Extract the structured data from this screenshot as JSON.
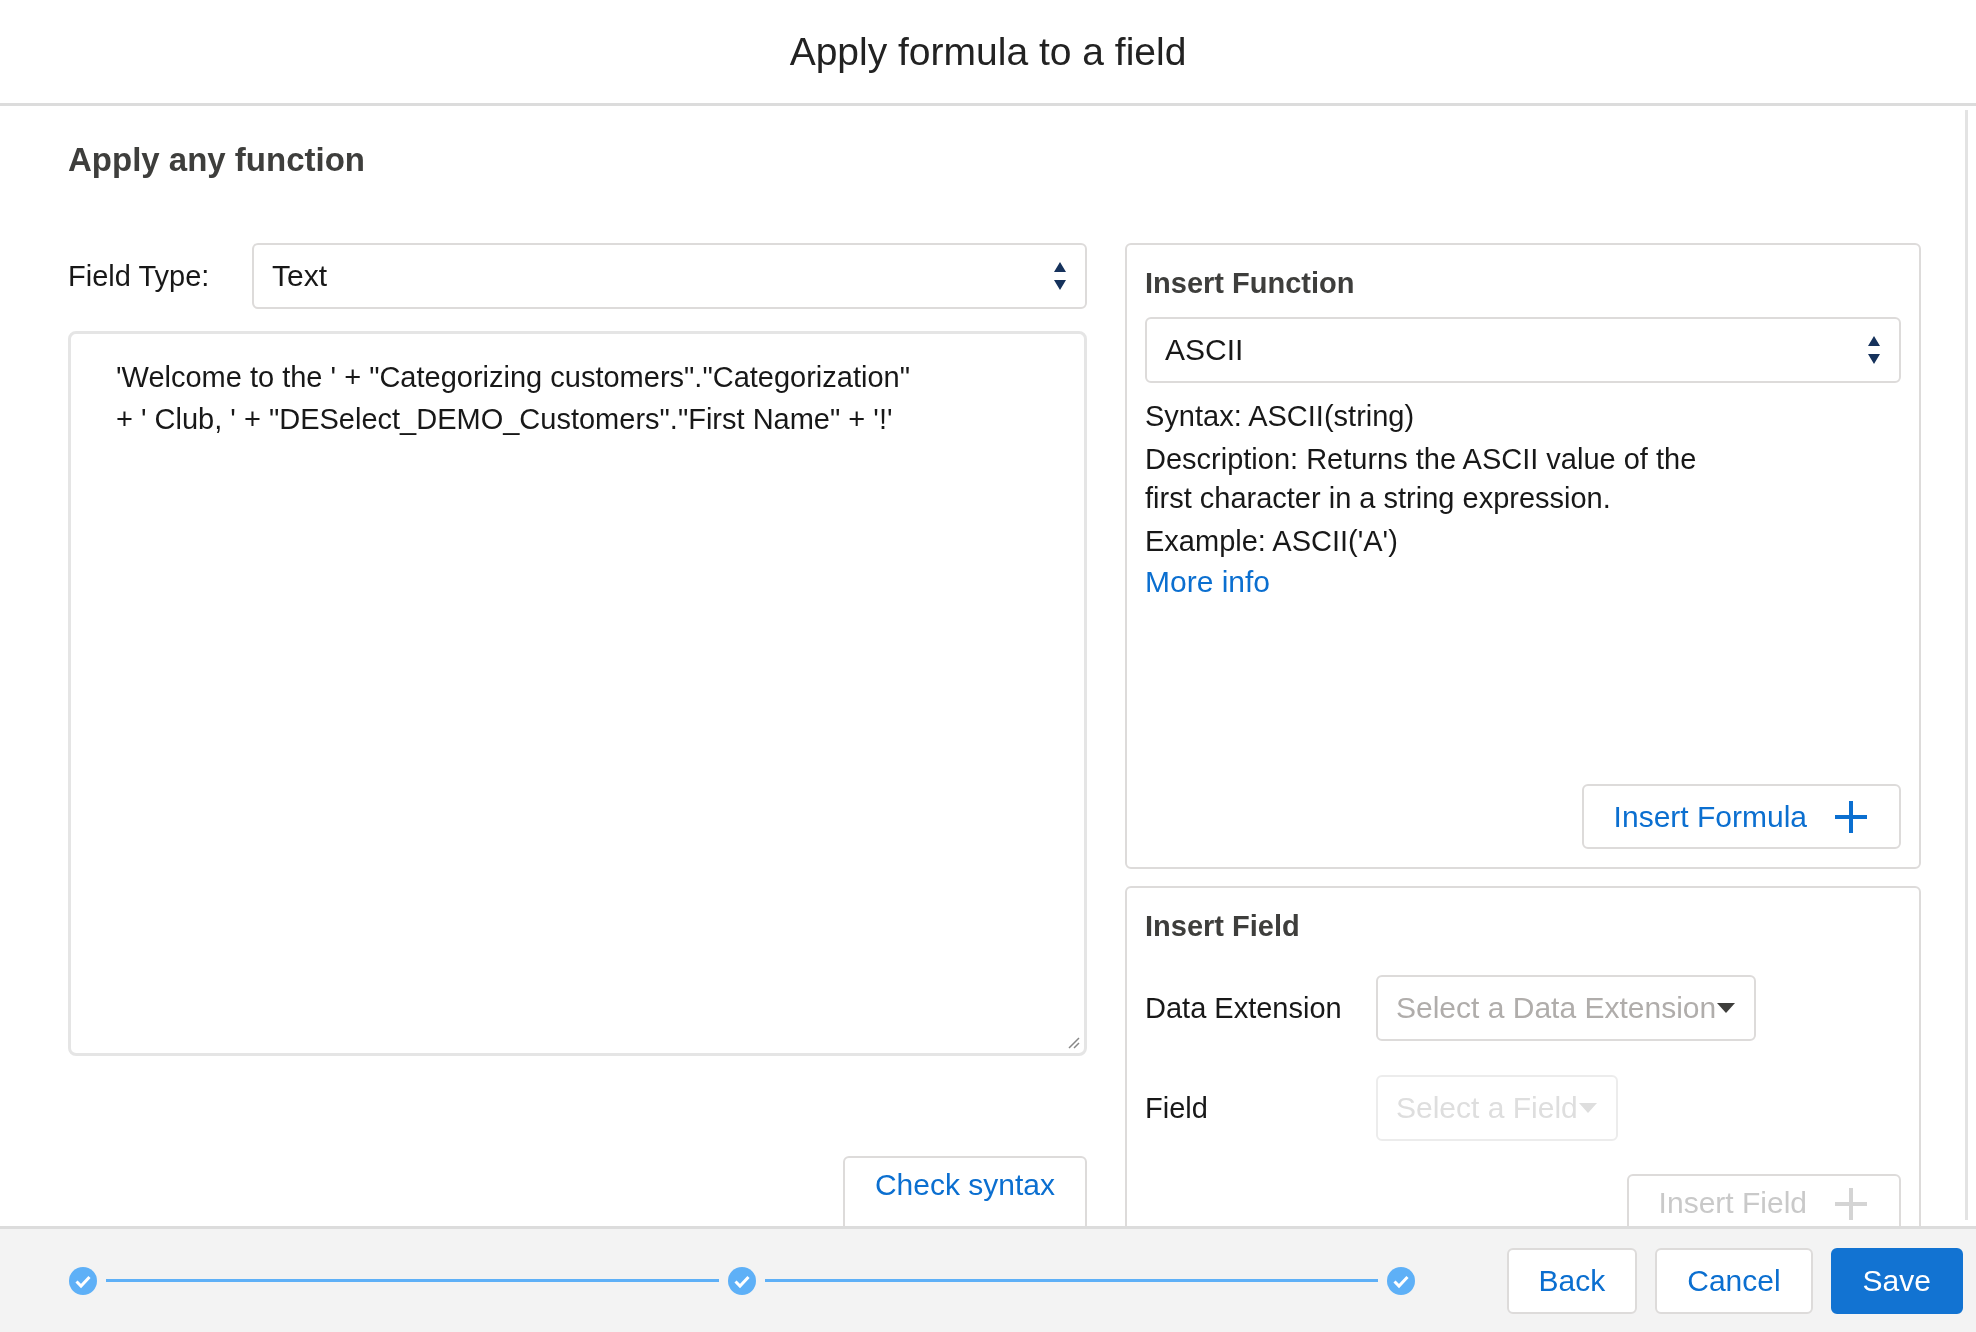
{
  "dialog": {
    "title": "Apply formula to a field"
  },
  "section_title": "Apply any function",
  "field_type": {
    "label": "Field Type:",
    "value": "Text"
  },
  "formula": {
    "lines": [
      "'Welcome to the ' + \"Categorizing customers\".\"Categorization\"",
      "+ ' Club, ' + \"DESelect_DEMO_Customers\".\"First Name\" + '!'"
    ]
  },
  "check_syntax_button": "Check syntax",
  "insert_function": {
    "title": "Insert Function",
    "function": "ASCII",
    "syntax": "Syntax: ASCII(string)",
    "description": "Description: Returns the ASCII value of the first character in a string expression.",
    "example": "Example: ASCII('A')",
    "more_info": "More info",
    "button": "Insert Formula"
  },
  "insert_field": {
    "title": "Insert Field",
    "data_extension": {
      "label": "Data Extension",
      "placeholder": "Select a Data Extension",
      "disabled": false
    },
    "field": {
      "label": "Field",
      "placeholder": "Select a Field",
      "disabled": true
    },
    "button": {
      "label": "Insert Field",
      "disabled": true
    }
  },
  "steps": [
    {
      "completed": true
    },
    {
      "completed": true
    },
    {
      "completed": true
    }
  ],
  "footer_buttons": [
    {
      "label": "Back",
      "kind": "secondary"
    },
    {
      "label": "Cancel",
      "kind": "secondary"
    },
    {
      "label": "Save",
      "kind": "primary"
    }
  ]
}
